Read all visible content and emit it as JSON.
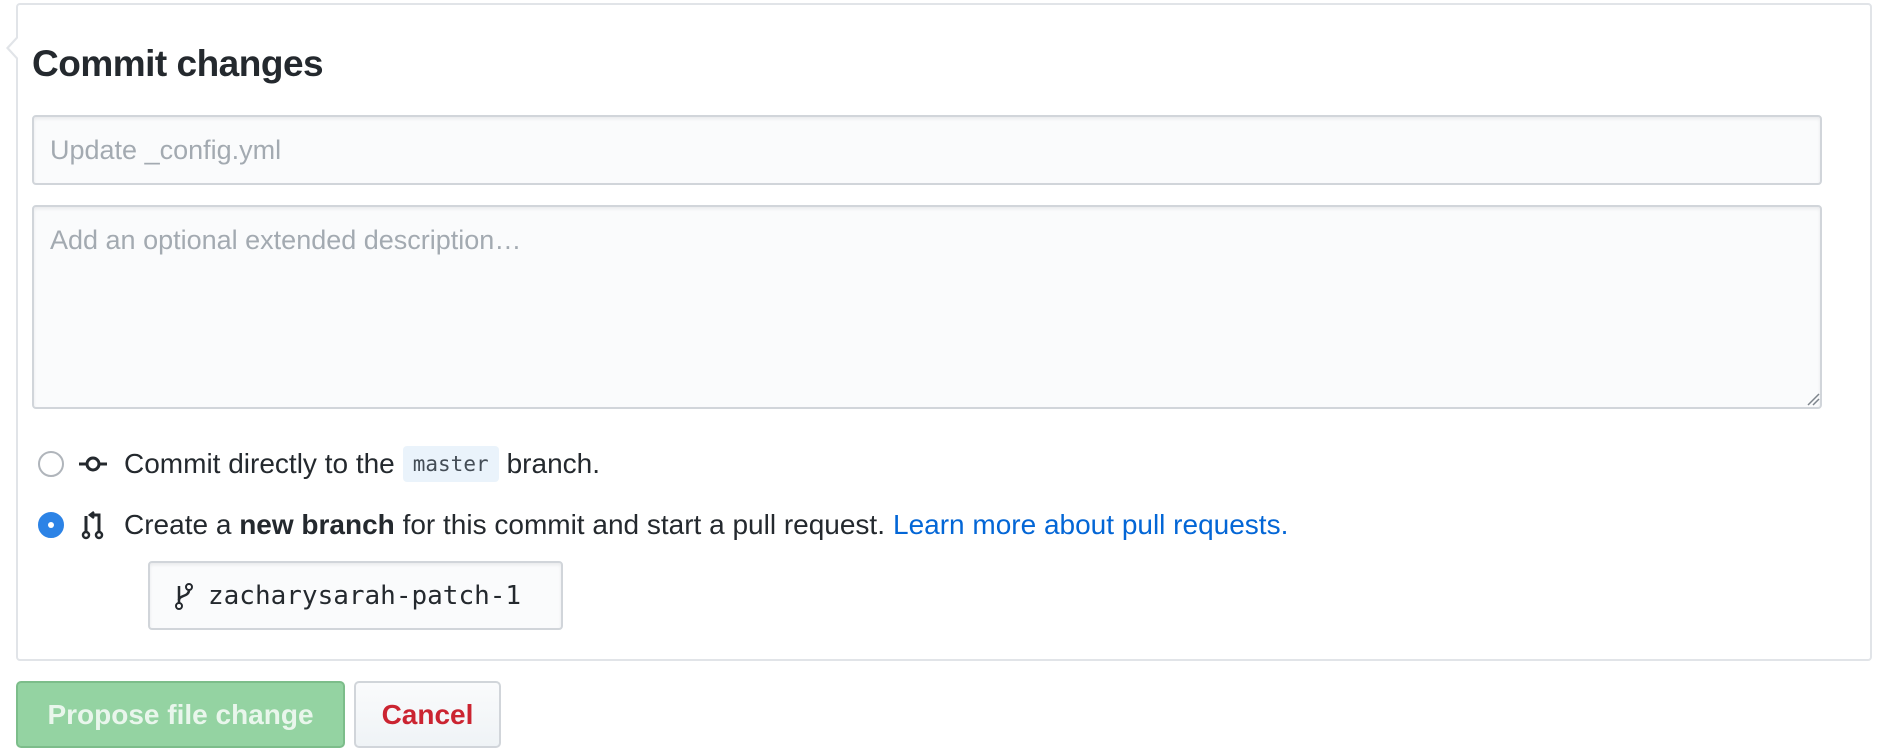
{
  "form": {
    "title": "Commit changes",
    "summary": {
      "placeholder": "Update _config.yml",
      "value": ""
    },
    "description": {
      "placeholder": "Add an optional extended description…",
      "value": ""
    }
  },
  "options": {
    "direct": {
      "selected": false,
      "icon": "git-commit-icon",
      "text_before": "Commit directly to the",
      "branch_name": "master",
      "text_after": "branch."
    },
    "new_branch": {
      "selected": true,
      "icon": "git-pull-request-icon",
      "text_before": "Create a",
      "bold_text": "new branch",
      "text_after": "for this commit and start a pull request.",
      "link_text": "Learn more about pull requests."
    }
  },
  "branch_input": {
    "icon": "git-branch-icon",
    "value": "zacharysarah-patch-1"
  },
  "buttons": {
    "propose": "Propose file change",
    "cancel": "Cancel"
  },
  "colors": {
    "propose_bg": "#94d3a2",
    "cancel_text": "#cb2431",
    "link": "#0366d6",
    "radio_checked": "#2c83e6"
  }
}
